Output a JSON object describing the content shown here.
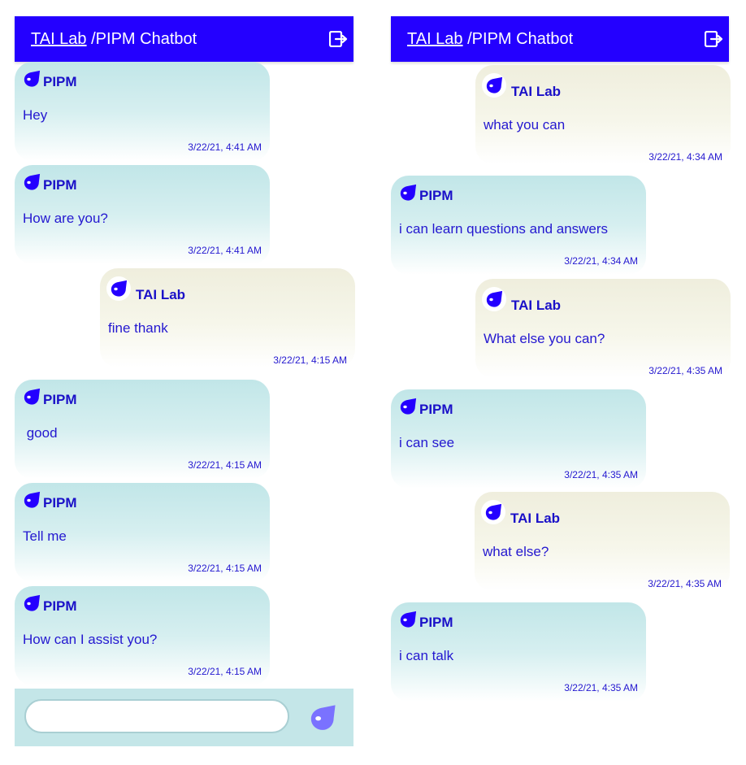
{
  "header": {
    "lab_link": "TAI Lab",
    "title_rest": " /PIPM Chatbot",
    "logout_icon": "logout-icon"
  },
  "colors": {
    "header_bg": "#2400ff",
    "bot_bubble": "#c1e6e8",
    "user_bubble": "#efeedd",
    "text": "#1a10c8",
    "composer_bg": "#c4e6e8",
    "send_icon": "#7a72ff"
  },
  "left_chat": {
    "messages": [
      {
        "sender": "PIPM",
        "role": "bot",
        "text": "Hey",
        "time": "3/22/21, 4:41 AM"
      },
      {
        "sender": "PIPM",
        "role": "bot",
        "text": "How are you?",
        "time": "3/22/21, 4:41 AM"
      },
      {
        "sender": "TAI Lab",
        "role": "user",
        "text": "fine thank",
        "time": "3/22/21, 4:15 AM"
      },
      {
        "sender": "PIPM",
        "role": "bot",
        "text": " good",
        "time": "3/22/21, 4:15 AM"
      },
      {
        "sender": "PIPM",
        "role": "bot",
        "text": "Tell me",
        "time": "3/22/21, 4:15 AM"
      },
      {
        "sender": "PIPM",
        "role": "bot",
        "text": "How can I assist you?",
        "time": "3/22/21, 4:15 AM"
      }
    ]
  },
  "right_chat": {
    "messages": [
      {
        "sender": "TAI Lab",
        "role": "user",
        "text": "what you can",
        "time": "3/22/21, 4:34 AM"
      },
      {
        "sender": "PIPM",
        "role": "bot",
        "text": "i can learn questions and answers",
        "time": "3/22/21, 4:34 AM"
      },
      {
        "sender": "TAI Lab",
        "role": "user",
        "text": "What else you can?",
        "time": "3/22/21, 4:35 AM"
      },
      {
        "sender": "PIPM",
        "role": "bot",
        "text": "i can see",
        "time": "3/22/21, 4:35 AM"
      },
      {
        "sender": "TAI Lab",
        "role": "user",
        "text": "what else?",
        "time": "3/22/21, 4:35 AM"
      },
      {
        "sender": "PIPM",
        "role": "bot",
        "text": "i can talk",
        "time": "3/22/21, 4:35 AM"
      }
    ]
  },
  "composer": {
    "input_value": "",
    "placeholder": "",
    "send_icon": "send-icon"
  }
}
